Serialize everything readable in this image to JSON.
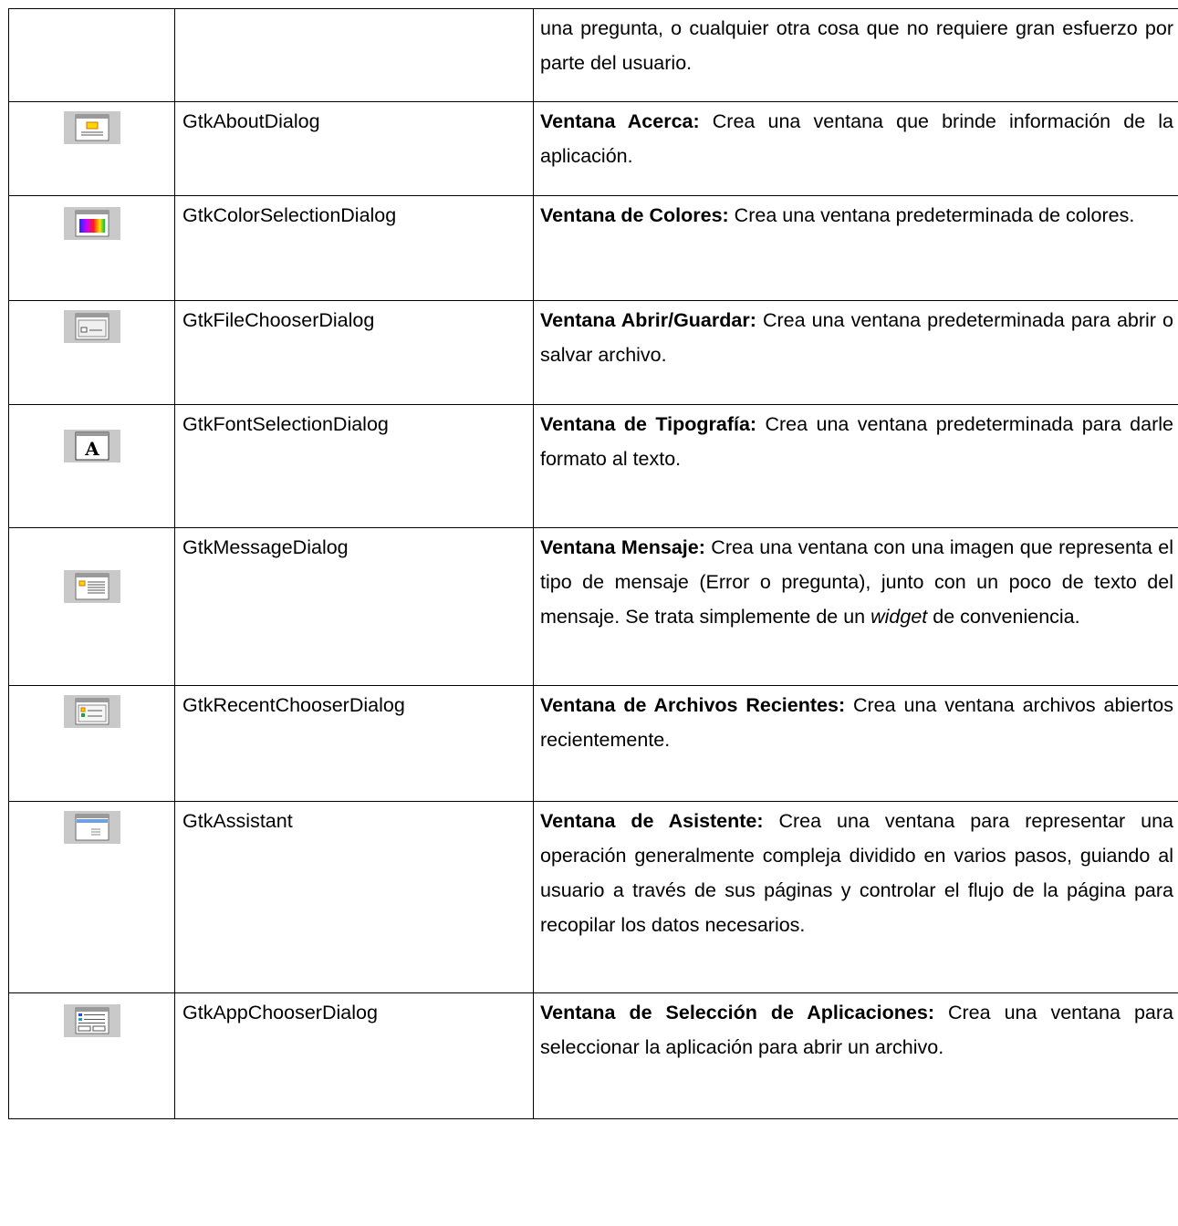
{
  "rows": [
    {
      "icon": "",
      "name": "",
      "title": "",
      "text": "una pregunta, o cualquier otra cosa que no requiere gran esfuerzo por parte del usuario."
    },
    {
      "icon": "about-dialog-icon",
      "name": "GtkAboutDialog",
      "title": "Ventana Acerca:",
      "text": " Crea una ventana que brinde información de la aplicación."
    },
    {
      "icon": "color-selection-dialog-icon",
      "name": "GtkColorSelectionDialog",
      "title": "Ventana de Colores:",
      "text": " Crea una ventana predeterminada de colores."
    },
    {
      "icon": "file-chooser-dialog-icon",
      "name": "GtkFileChooserDialog",
      "title": "Ventana Abrir/Guardar:",
      "text": " Crea una ventana predeterminada para abrir o salvar archivo."
    },
    {
      "icon": "font-selection-dialog-icon",
      "name": "GtkFontSelectionDialog",
      "title": "Ventana de Tipografía:",
      "text": " Crea una ventana predeterminada para darle formato al texto."
    },
    {
      "icon": "message-dialog-icon",
      "name": "GtkMessageDialog",
      "title": "Ventana Mensaje:",
      "text": " Crea una ventana con una imagen que representa el tipo de mensaje (Error o pregunta), junto con un poco de texto del mensaje. Se trata simplemente de un ",
      "italic": "widget",
      "text_after": " de conveniencia."
    },
    {
      "icon": "recent-chooser-dialog-icon",
      "name": "GtkRecentChooserDialog",
      "title": "Ventana de Archivos Recientes:",
      "text": " Crea una ventana archivos abiertos recientemente."
    },
    {
      "icon": "assistant-icon",
      "name": "GtkAssistant",
      "title": "Ventana de Asistente:",
      "text": " Crea una ventana para representar una operación generalmente compleja dividido en varios pasos, guiando al usuario a través de sus páginas y controlar el flujo de la página para recopilar los datos necesarios."
    },
    {
      "icon": "app-chooser-dialog-icon",
      "name": "GtkAppChooserDialog",
      "title": "Ventana de Selección de Aplicaciones:",
      "text": " Crea una ventana para seleccionar la aplicación para abrir un archivo."
    }
  ]
}
